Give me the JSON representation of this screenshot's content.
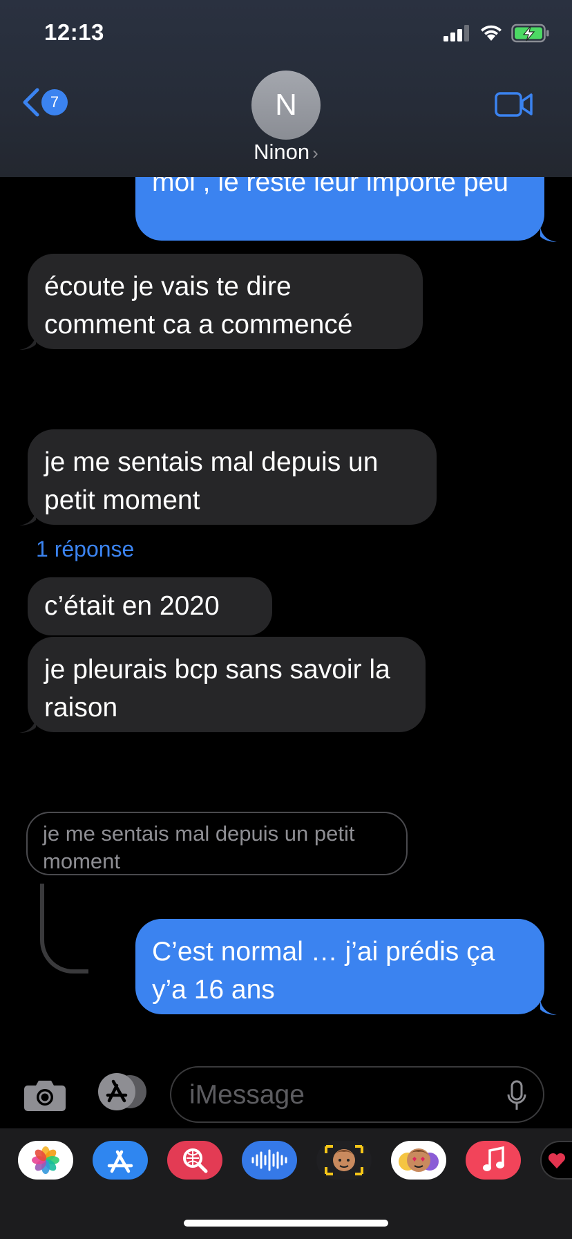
{
  "status_bar": {
    "time": "12:13"
  },
  "header": {
    "back_badge": "7",
    "avatar_initial": "N",
    "contact_name": "Ninon",
    "name_chevron": "›"
  },
  "messages": [
    {
      "direction": "out",
      "text": "moi , le reste leur importe peu"
    },
    {
      "direction": "in",
      "text": "écoute je vais te dire comment ca a commencé"
    },
    {
      "direction": "in",
      "text": "je me sentais mal depuis un petit moment"
    },
    {
      "direction": "in",
      "text": "c’était en 2020"
    },
    {
      "direction": "in",
      "text": "je pleurais bcp sans savoir la raison"
    },
    {
      "direction": "out",
      "text": "C’est normal … j’ai prédis ça y’a 16 ans"
    }
  ],
  "reply_link": "1 réponse",
  "quoted_message": "je me sentais mal depuis un petit moment",
  "input": {
    "placeholder": "iMessage"
  },
  "app_drawer": [
    "photos-app-icon",
    "app-store-icon",
    "web-search-icon",
    "audio-message-icon",
    "memoji-icon",
    "memoji-stickers-icon",
    "music-icon",
    "digital-touch-icon"
  ],
  "colors": {
    "outgoing": "#3b83f0",
    "incoming": "#262628",
    "accent": "#3b83f0"
  }
}
